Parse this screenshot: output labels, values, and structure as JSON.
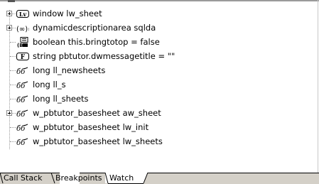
{
  "watch": {
    "items": [
      {
        "label": "window lw_sheet",
        "icon": "window-object-icon",
        "expandable": true
      },
      {
        "label": "dynamicdescriptionarea sqlda",
        "icon": "structure-variable-icon",
        "expandable": true
      },
      {
        "label": "boolean this.bringtotop = false",
        "icon": "boolean-property-icon",
        "expandable": false
      },
      {
        "label": "string pbtutor.dwmessagetitle = \"\"",
        "icon": "string-function-icon",
        "expandable": false
      },
      {
        "label": "long ll_newsheets",
        "icon": "watch-glasses-icon",
        "expandable": false
      },
      {
        "label": "long ll_s",
        "icon": "watch-glasses-icon",
        "expandable": false
      },
      {
        "label": "long ll_sheets",
        "icon": "watch-glasses-icon",
        "expandable": false
      },
      {
        "label": "w_pbtutor_basesheet aw_sheet",
        "icon": "watch-glasses-icon",
        "expandable": true
      },
      {
        "label": "w_pbtutor_basesheet lw_init",
        "icon": "watch-glasses-icon",
        "expandable": false
      },
      {
        "label": "w_pbtutor_basesheet lw_sheets",
        "icon": "watch-glasses-icon",
        "expandable": false
      }
    ]
  },
  "tabs": [
    {
      "label": "Call Stack",
      "active": false
    },
    {
      "label": "Breakpoints",
      "active": false
    },
    {
      "label": "Watch",
      "active": true
    }
  ]
}
